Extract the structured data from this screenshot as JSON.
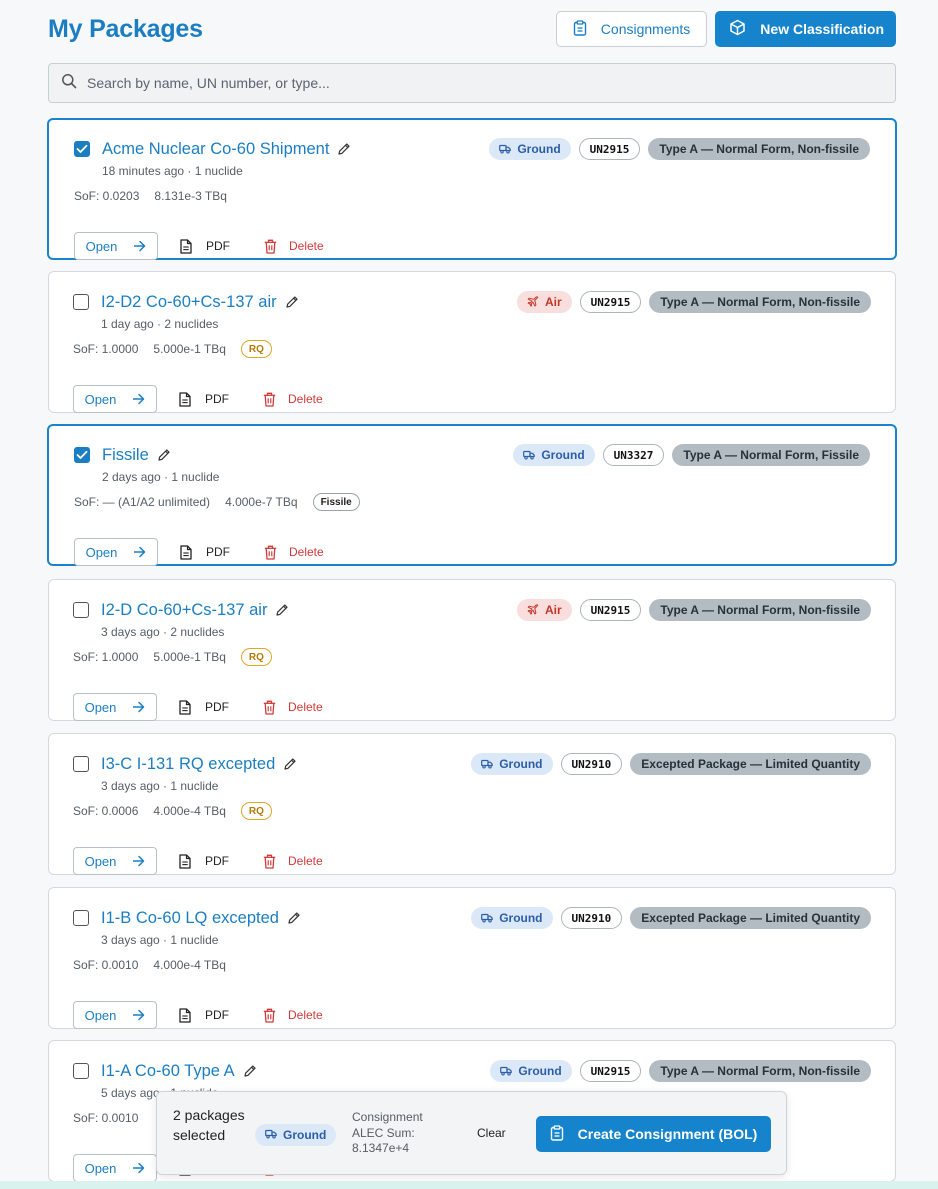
{
  "header": {
    "title": "My Packages",
    "consignments_label": "Consignments",
    "new_classification_label": "New Classification"
  },
  "search": {
    "placeholder": "Search by name, UN number, or type..."
  },
  "colors": {
    "accent": "#1b7ec2",
    "primary_button": "#1684cc",
    "delete": "#d23a3a",
    "rq": "#e3a52a"
  },
  "actions": {
    "open": "Open",
    "pdf": "PDF",
    "delete": "Delete"
  },
  "packages": [
    {
      "name": "Acme Nuclear Co-60 Shipment",
      "checked": true,
      "meta": "18 minutes ago · 1 nuclide",
      "sof": "SoF: 0.0203",
      "activity": "8.131e-3 TBq",
      "flag": "",
      "mode": "Ground",
      "mode_kind": "ground",
      "un": "UN2915",
      "type": "Type A — Normal Form, Non-fissile"
    },
    {
      "name": "I2-D2 Co-60+Cs-137 air",
      "checked": false,
      "meta": "1 day ago · 2 nuclides",
      "sof": "SoF: 1.0000",
      "activity": "5.000e-1 TBq",
      "flag": "RQ",
      "mode": "Air",
      "mode_kind": "air",
      "un": "UN2915",
      "type": "Type A — Normal Form, Non-fissile"
    },
    {
      "name": "Fissile",
      "checked": true,
      "meta": "2 days ago · 1 nuclide",
      "sof": "SoF: — (A1/A2 unlimited)",
      "activity": "4.000e-7 TBq",
      "flag": "Fissile",
      "mode": "Ground",
      "mode_kind": "ground",
      "un": "UN3327",
      "type": "Type A — Normal Form, Fissile"
    },
    {
      "name": "I2-D Co-60+Cs-137 air",
      "checked": false,
      "meta": "3 days ago · 2 nuclides",
      "sof": "SoF: 1.0000",
      "activity": "5.000e-1 TBq",
      "flag": "RQ",
      "mode": "Air",
      "mode_kind": "air",
      "un": "UN2915",
      "type": "Type A — Normal Form, Non-fissile"
    },
    {
      "name": "I3-C I-131 RQ excepted",
      "checked": false,
      "meta": "3 days ago · 1 nuclide",
      "sof": "SoF: 0.0006",
      "activity": "4.000e-4 TBq",
      "flag": "RQ",
      "mode": "Ground",
      "mode_kind": "ground",
      "un": "UN2910",
      "type": "Excepted Package — Limited Quantity"
    },
    {
      "name": "I1-B Co-60 LQ excepted",
      "checked": false,
      "meta": "3 days ago · 1 nuclide",
      "sof": "SoF: 0.0010",
      "activity": "4.000e-4 TBq",
      "flag": "",
      "mode": "Ground",
      "mode_kind": "ground",
      "un": "UN2910",
      "type": "Excepted Package — Limited Quantity"
    },
    {
      "name": "I1-A Co-60 Type A",
      "checked": false,
      "meta": "5 days ago · 1 nuclide",
      "sof": "SoF: 0.0010",
      "activity": "",
      "flag": "",
      "mode": "Ground",
      "mode_kind": "ground",
      "un": "UN2915",
      "type": "Type A — Normal Form, Non-fissile"
    }
  ],
  "selection_bar": {
    "count": "2 packages selected",
    "mode": "Ground",
    "consignment_label": "Consignment ALEC Sum: 8.1347e+4",
    "clear": "Clear",
    "create": "Create Consignment (BOL)"
  }
}
